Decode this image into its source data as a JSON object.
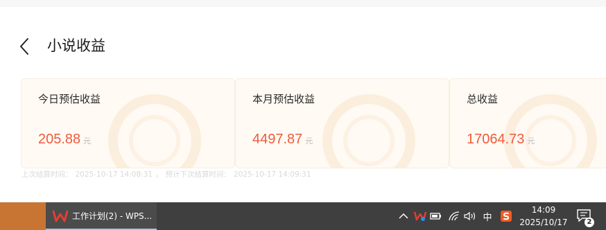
{
  "header": {
    "title": "小说收益"
  },
  "cards": [
    {
      "label": "今日预估收益",
      "amount": "205.88",
      "unit": "元"
    },
    {
      "label": "本月预估收益",
      "amount": "4497.87",
      "unit": "元"
    },
    {
      "label": "总收益",
      "amount": "17064.73",
      "unit": "元"
    }
  ],
  "settlement": {
    "last_label": "上次结算时间：",
    "last_time": "2025-10-17 14:08:31",
    "separator": "，",
    "next_label": "预计下次结算时间：",
    "next_time": "2025-10-17 14:09:31"
  },
  "colors": {
    "amount": "#f05a3c",
    "card_bg": "#fffaf3",
    "taskbar": "#3f3f3f",
    "start_block": "#c87533"
  },
  "taskbar": {
    "active_window_label": "工作计划(2) - WPS...",
    "tray": {
      "ime_label": "中",
      "clock_time": "14:09",
      "clock_date": "2025/10/17",
      "notification_count": "2"
    }
  }
}
